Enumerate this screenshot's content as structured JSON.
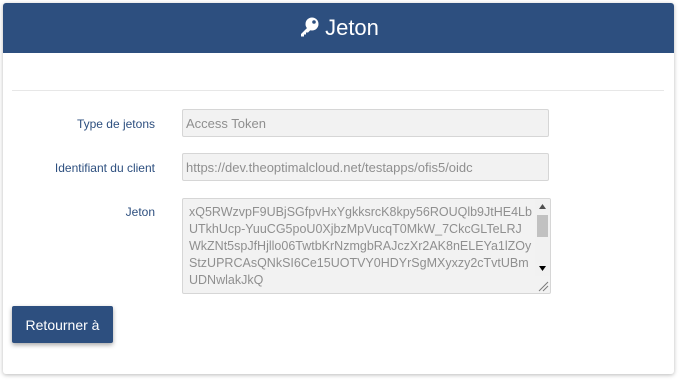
{
  "header": {
    "title": "Jeton",
    "icon": "key-icon"
  },
  "form": {
    "token_type": {
      "label": "Type de jetons",
      "value": "Access Token"
    },
    "client_id": {
      "label": "Identifiant du client",
      "value": "https://dev.theoptimalcloud.net/testapps/ofis5/oidc"
    },
    "token": {
      "label": "Jeton",
      "value": "xQ5RWzvpF9UBjSGfpvHxYgkksrcK8kpy56ROUQlb9JtHE4LbUTkhUcp-YuuCG5poU0XjbzMpVucqT0MkW_7CkcGLTeLRJWkZNt5spJfHjllo06TwtbKrNzmgbRAJczXr2AK8nELEYa1lZOyStzUPRCAsQNkSI6Ce15UOTVY0HDYrSgMXyxzy2cTvtUBmUDNwlakJkQ"
    }
  },
  "actions": {
    "back_label": "Retourner à"
  },
  "colors": {
    "primary": "#2d4f7f",
    "field_bg": "#f2f2f2",
    "field_text": "#8f8f8f"
  }
}
